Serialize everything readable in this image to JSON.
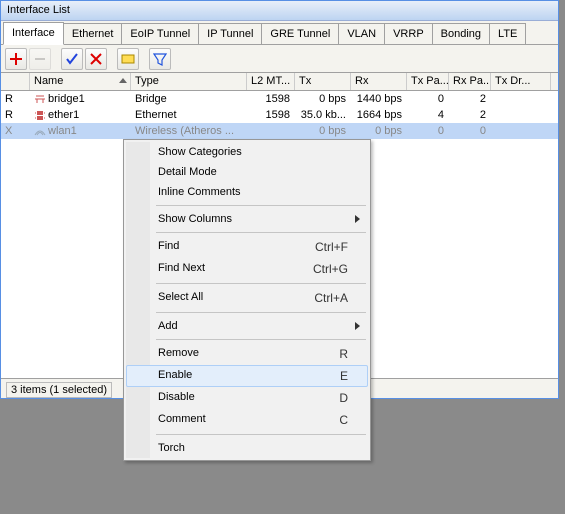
{
  "window_title": "Interface List",
  "tabs": [
    "Interface",
    "Ethernet",
    "EoIP Tunnel",
    "IP Tunnel",
    "GRE Tunnel",
    "VLAN",
    "VRRP",
    "Bonding",
    "LTE"
  ],
  "active_tab": 0,
  "columns": [
    "",
    "Name",
    "Type",
    "L2 MT...",
    "Tx",
    "Rx",
    "Tx Pa...",
    "Rx Pa...",
    "Tx Dr..."
  ],
  "rows": [
    {
      "flag": "R",
      "icon": "bridge",
      "name": "bridge1",
      "type": "Bridge",
      "l2": "1598",
      "tx": "0 bps",
      "rx": "1440 bps",
      "txp": "0",
      "rxp": "2"
    },
    {
      "flag": "R",
      "icon": "eth",
      "name": "ether1",
      "type": "Ethernet",
      "l2": "1598",
      "tx": "35.0 kb...",
      "rx": "1664 bps",
      "txp": "4",
      "rxp": "2"
    },
    {
      "flag": "X",
      "icon": "wlan",
      "name": "wlan1",
      "type": "Wireless (Atheros ...",
      "l2": "",
      "tx": "0 bps",
      "rx": "0 bps",
      "txp": "0",
      "rxp": "0",
      "selected": true
    }
  ],
  "status": "3 items (1 selected)",
  "menu": {
    "show_categories": "Show Categories",
    "detail_mode": "Detail Mode",
    "inline_comments": "Inline Comments",
    "show_columns": "Show Columns",
    "find": "Find",
    "find_sc": "Ctrl+F",
    "find_next": "Find Next",
    "find_next_sc": "Ctrl+G",
    "select_all": "Select All",
    "select_all_sc": "Ctrl+A",
    "add": "Add",
    "remove": "Remove",
    "remove_sc": "R",
    "enable": "Enable",
    "enable_sc": "E",
    "disable": "Disable",
    "disable_sc": "D",
    "comment": "Comment",
    "comment_sc": "C",
    "torch": "Torch"
  }
}
